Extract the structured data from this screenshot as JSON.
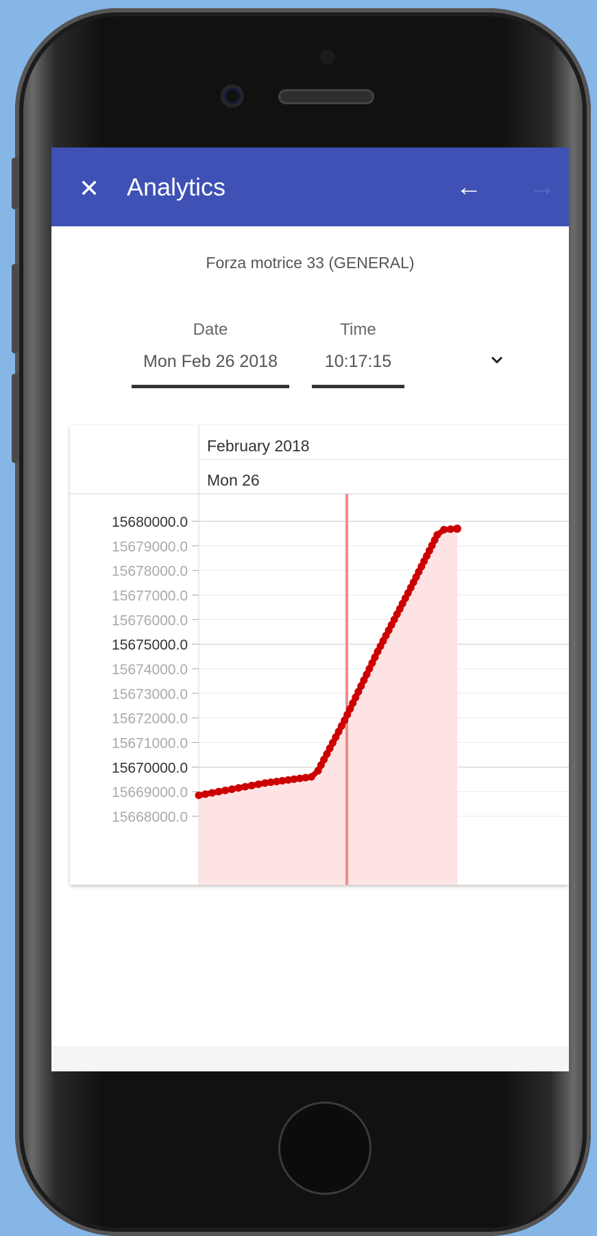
{
  "app": {
    "title": "Analytics",
    "close_icon": "close-icon",
    "back_icon": "arrow-back-icon",
    "forward_icon": "arrow-forward-icon",
    "accent": "#3f51b5"
  },
  "device": {
    "name": "Forza motrice 33 (GENERAL)"
  },
  "filters": {
    "date_label": "Date",
    "date_value": "Mon Feb 26 2018",
    "time_label": "Time",
    "time_value": "10:17:15",
    "expand_icon": "chevron-down-icon"
  },
  "chart_data": {
    "type": "area",
    "header_month": "February 2018",
    "header_day": "Mon 26",
    "ylim": [
      15667500,
      15680800
    ],
    "yticks": [
      {
        "label": "15680000.0",
        "value": 15680000,
        "major": true
      },
      {
        "label": "15679000.0",
        "value": 15679000,
        "major": false
      },
      {
        "label": "15678000.0",
        "value": 15678000,
        "major": false
      },
      {
        "label": "15677000.0",
        "value": 15677000,
        "major": false
      },
      {
        "label": "15676000.0",
        "value": 15676000,
        "major": false
      },
      {
        "label": "15675000.0",
        "value": 15675000,
        "major": true
      },
      {
        "label": "15674000.0",
        "value": 15674000,
        "major": false
      },
      {
        "label": "15673000.0",
        "value": 15673000,
        "major": false
      },
      {
        "label": "15672000.0",
        "value": 15672000,
        "major": false
      },
      {
        "label": "15671000.0",
        "value": 15671000,
        "major": false
      },
      {
        "label": "15670000.0",
        "value": 15670000,
        "major": true
      },
      {
        "label": "15669000.0",
        "value": 15669000,
        "major": false
      },
      {
        "label": "15668000.0",
        "value": 15668000,
        "major": false
      }
    ],
    "xlim": [
      0,
      100
    ],
    "cursor_x": 44.7,
    "series": [
      {
        "color": "#cc0000",
        "fill": "#fde3e3",
        "points": [
          {
            "x": 0,
            "y": 15668850
          },
          {
            "x": 10,
            "y": 15669100
          },
          {
            "x": 20,
            "y": 15669350
          },
          {
            "x": 34,
            "y": 15669600
          },
          {
            "x": 36,
            "y": 15669850
          },
          {
            "x": 44,
            "y": 15671900
          },
          {
            "x": 54,
            "y": 15674700
          },
          {
            "x": 64,
            "y": 15677300
          },
          {
            "x": 72,
            "y": 15679450
          },
          {
            "x": 74,
            "y": 15679660
          },
          {
            "x": 78,
            "y": 15679700
          }
        ]
      }
    ]
  }
}
